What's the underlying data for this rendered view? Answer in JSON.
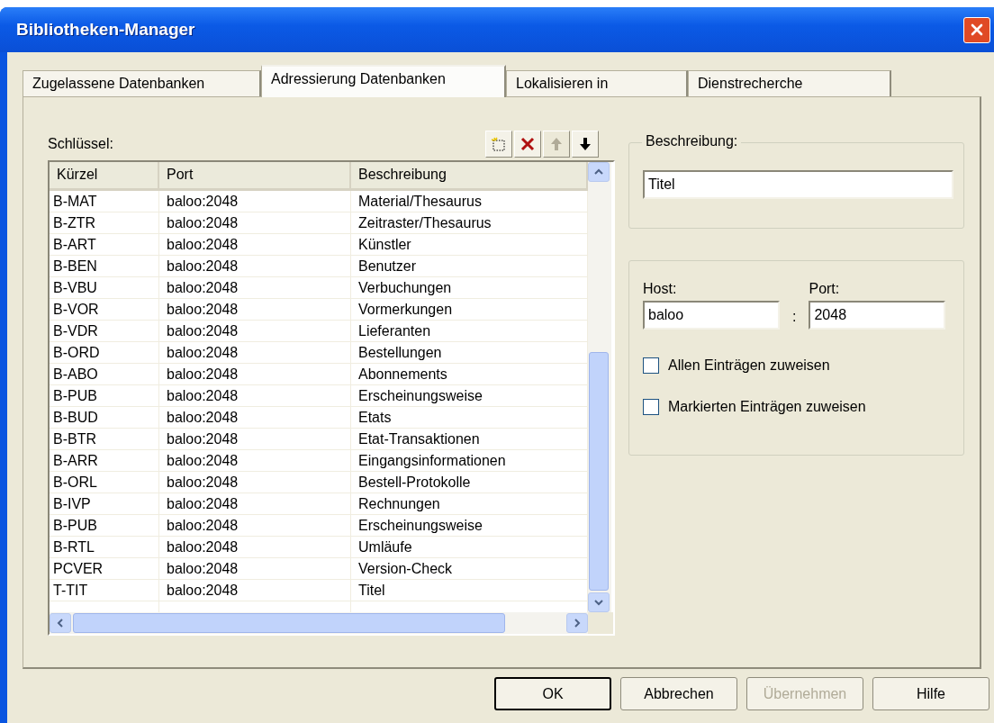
{
  "window": {
    "title": "Bibliotheken-Manager"
  },
  "tabs": [
    {
      "label": "Zugelassene Datenbanken",
      "selected": false
    },
    {
      "label": "Adressierung Datenbanken",
      "selected": true
    },
    {
      "label": "Lokalisieren in",
      "selected": false
    },
    {
      "label": "Dienstrecherche",
      "selected": false
    }
  ],
  "keys_label": "Schlüssel:",
  "toolbar": [
    {
      "kind": "new",
      "disabled": false
    },
    {
      "kind": "delete",
      "disabled": false
    },
    {
      "kind": "up",
      "disabled": true
    },
    {
      "kind": "down",
      "disabled": false
    }
  ],
  "table": {
    "columns": [
      "Kürzel",
      "Port",
      "Beschreibung"
    ],
    "rows": [
      [
        "B-MAT",
        "baloo:2048",
        "Material/Thesaurus"
      ],
      [
        "B-ZTR",
        "baloo:2048",
        "Zeitraster/Thesaurus"
      ],
      [
        "B-ART",
        "baloo:2048",
        "Künstler"
      ],
      [
        "B-BEN",
        "baloo:2048",
        "Benutzer"
      ],
      [
        "B-VBU",
        "baloo:2048",
        "Verbuchungen"
      ],
      [
        "B-VOR",
        "baloo:2048",
        "Vormerkungen"
      ],
      [
        "B-VDR",
        "baloo:2048",
        "Lieferanten"
      ],
      [
        "B-ORD",
        "baloo:2048",
        "Bestellungen"
      ],
      [
        "B-ABO",
        "baloo:2048",
        "Abonnements"
      ],
      [
        "B-PUB",
        "baloo:2048",
        "Erscheinungsweise"
      ],
      [
        "B-BUD",
        "baloo:2048",
        "Etats"
      ],
      [
        "B-BTR",
        "baloo:2048",
        "Etat-Transaktionen"
      ],
      [
        "B-ARR",
        "baloo:2048",
        "Eingangsinformationen"
      ],
      [
        "B-ORL",
        "baloo:2048",
        "Bestell-Protokolle"
      ],
      [
        "B-IVP",
        "baloo:2048",
        "Rechnungen"
      ],
      [
        "B-PUB",
        "baloo:2048",
        "Erscheinungsweise"
      ],
      [
        "B-RTL",
        "baloo:2048",
        "Umläufe"
      ],
      [
        "PCVER",
        "baloo:2048",
        "Version-Check"
      ],
      [
        "T-TIT",
        "baloo:2048",
        "Titel"
      ]
    ]
  },
  "description": {
    "legend": "Beschreibung:",
    "value": "Titel"
  },
  "connection": {
    "host_label": "Host:",
    "host": "baloo",
    "separator": ":",
    "port_label": "Port:",
    "port": "2048",
    "checkboxes": [
      {
        "label": "Allen Einträgen zuweisen",
        "checked": false
      },
      {
        "label": "Markierten Einträgen zuweisen",
        "checked": false
      }
    ]
  },
  "buttons": [
    {
      "label": "OK",
      "default": true,
      "disabled": false
    },
    {
      "label": "Abbrechen",
      "default": false,
      "disabled": false
    },
    {
      "label": "Übernehmen",
      "default": false,
      "disabled": true
    },
    {
      "label": "Hilfe",
      "default": false,
      "disabled": false
    }
  ]
}
